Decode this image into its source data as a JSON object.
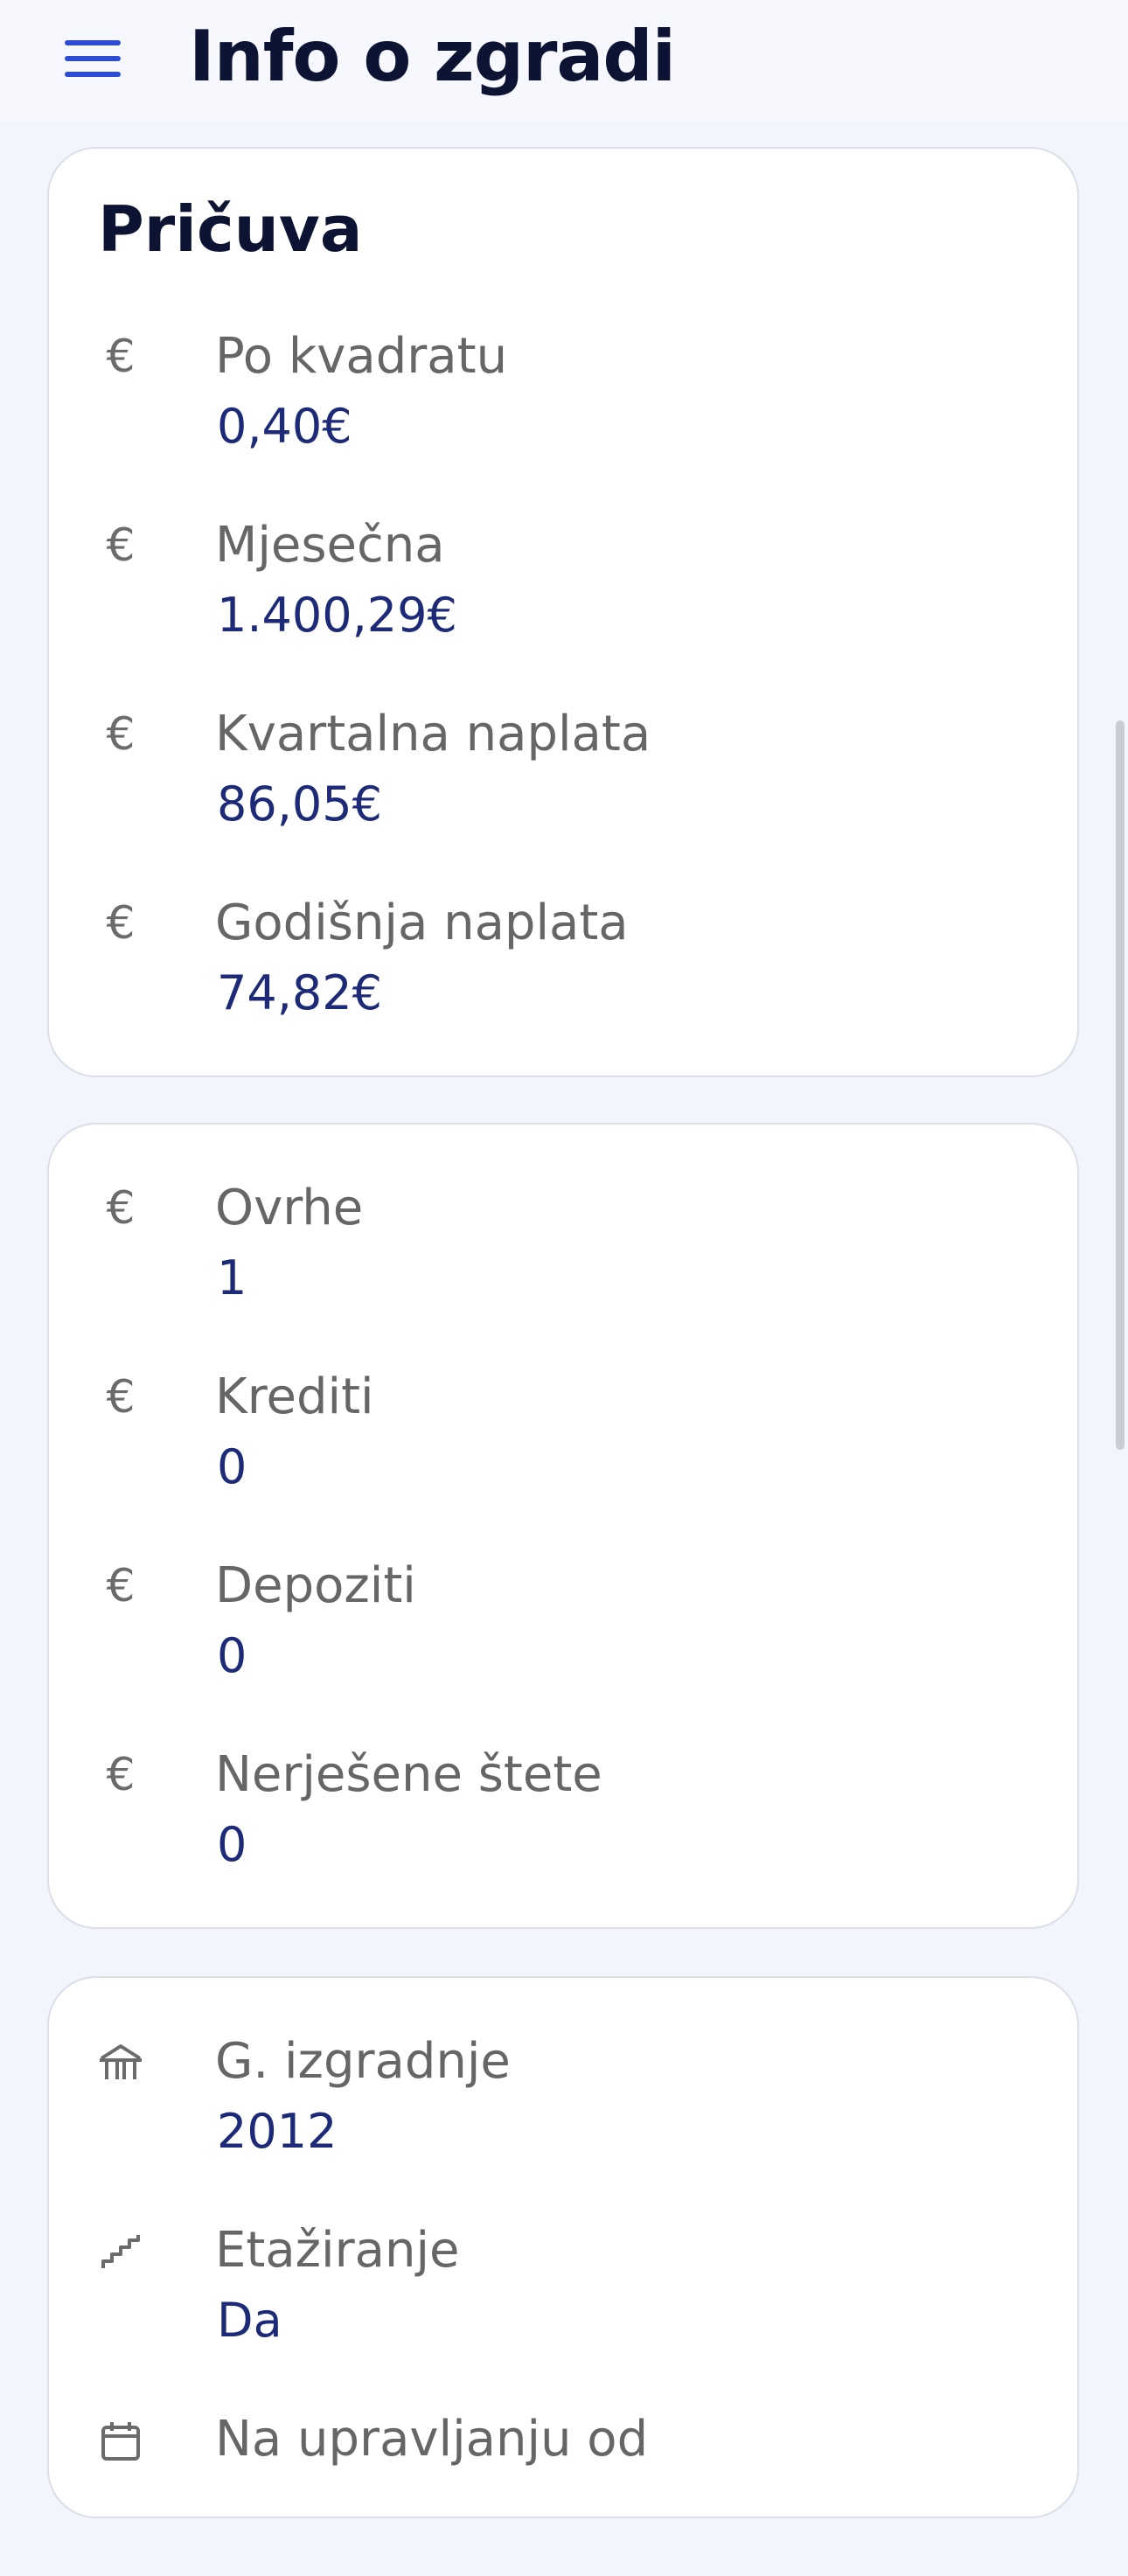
{
  "header": {
    "title": "Info o zgradi",
    "menu_icon": "hamburger-menu-icon",
    "accent_color": "#2e4bd6"
  },
  "reserve_card": {
    "title": "Pričuva",
    "rows": [
      {
        "icon": "euro-icon",
        "label": "Po kvadratu",
        "value": "0,40€"
      },
      {
        "icon": "euro-icon",
        "label": "Mjesečna",
        "value": "1.400,29€"
      },
      {
        "icon": "euro-icon",
        "label": "Kvartalna naplata",
        "value": "86,05€"
      },
      {
        "icon": "euro-icon",
        "label": "Godišnja naplata",
        "value": "74,82€"
      }
    ]
  },
  "finance_card": {
    "rows": [
      {
        "icon": "euro-icon",
        "label": "Ovrhe",
        "value": "1"
      },
      {
        "icon": "euro-icon",
        "label": "Krediti",
        "value": "0"
      },
      {
        "icon": "euro-icon",
        "label": "Depoziti",
        "value": "0"
      },
      {
        "icon": "euro-icon",
        "label": "Nerješene štete",
        "value": "0"
      }
    ]
  },
  "building_card": {
    "rows": [
      {
        "icon": "building-icon",
        "label": "G. izgradnje",
        "value": "2012"
      },
      {
        "icon": "stairs-icon",
        "label": "Etažiranje",
        "value": "Da"
      },
      {
        "icon": "calendar-icon",
        "label": "Na upravljanju od",
        "value": ""
      }
    ]
  },
  "colors": {
    "background": "#f3f5fc",
    "title": "#0d1333",
    "label": "#666666",
    "value": "#1c2a78"
  }
}
